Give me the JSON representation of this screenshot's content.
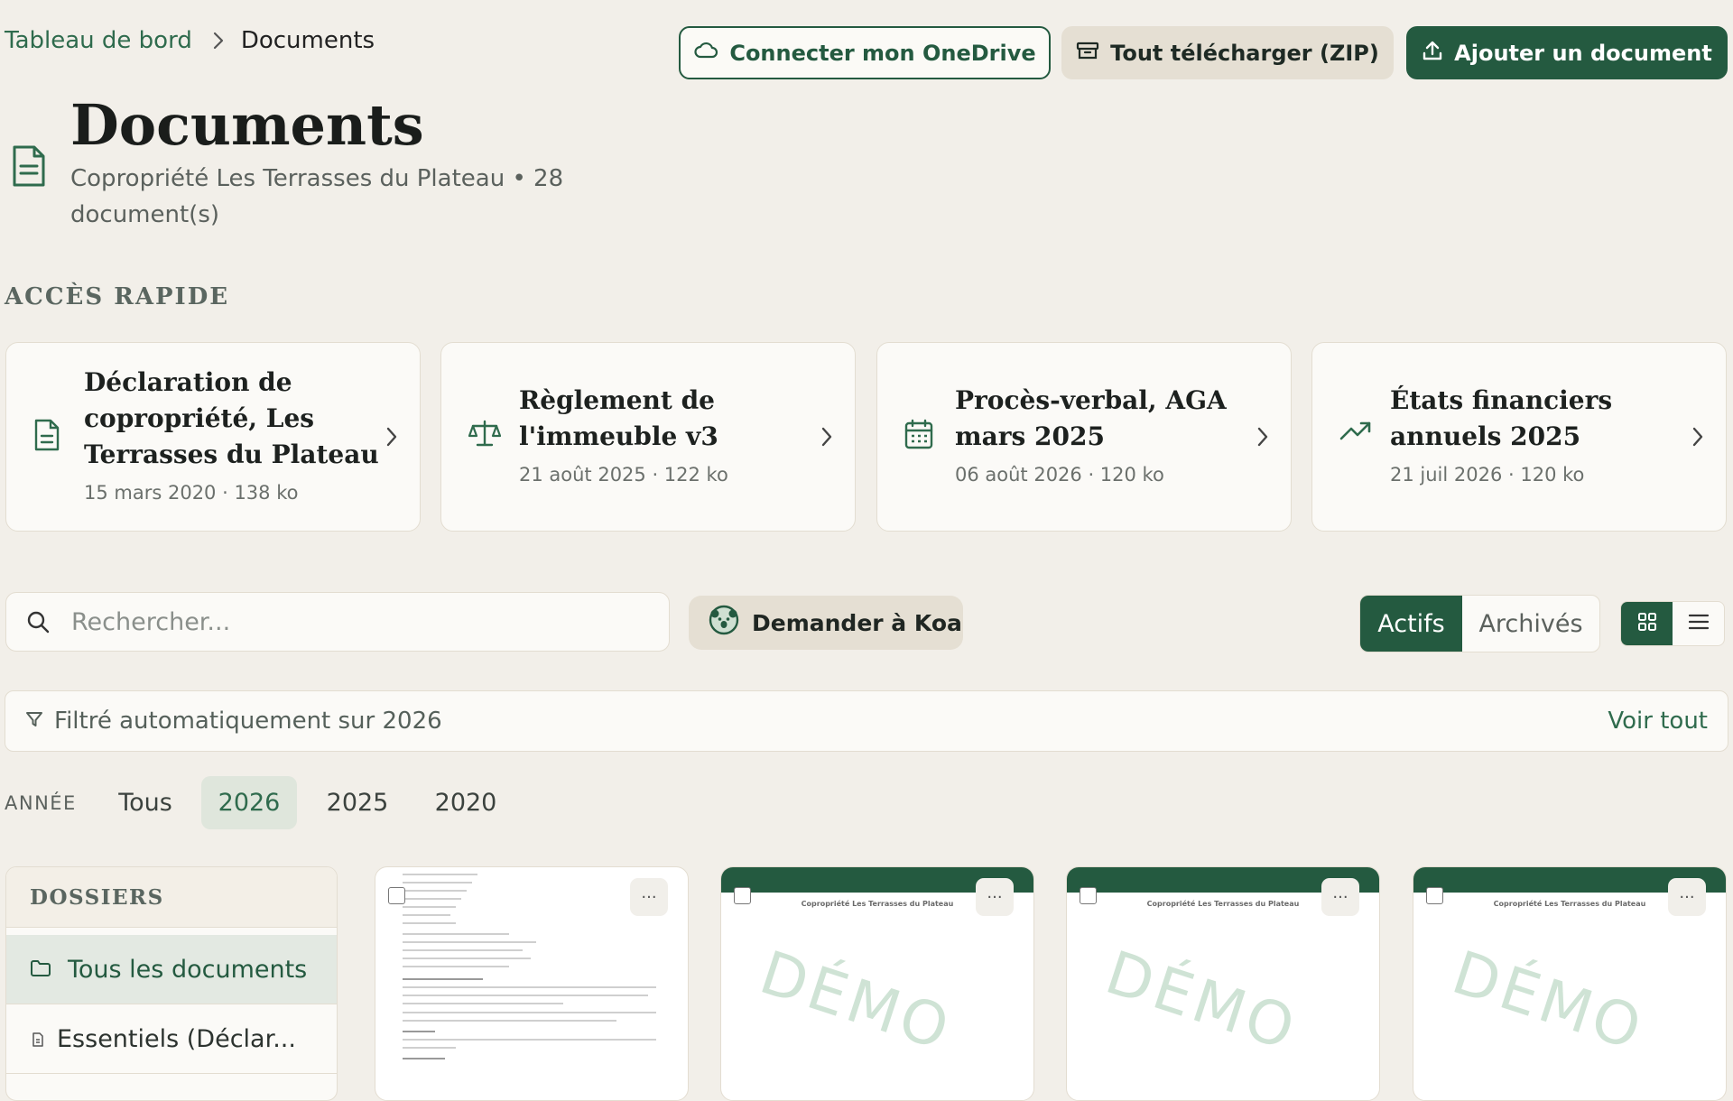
{
  "breadcrumb": {
    "home": "Tableau de bord",
    "current": "Documents"
  },
  "toolbar": {
    "onedrive_label": "Connecter mon OneDrive",
    "zip_label": "Tout télécharger (ZIP)",
    "add_label": "Ajouter un document"
  },
  "header": {
    "title": "Documents",
    "subtitle": "Copropriété Les Terrasses du Plateau • 28 document(s)"
  },
  "quick_access": {
    "label": "ACCÈS RAPIDE",
    "items": [
      {
        "title": "Déclaration de copropriété, Les Terrasses du Plateau",
        "meta": "15 mars 2020 · 138 ko",
        "icon": "document-icon"
      },
      {
        "title": "Règlement de l'immeuble v3",
        "meta": "21 août 2025 · 122 ko",
        "icon": "scale-icon"
      },
      {
        "title": "Procès-verbal, AGA mars 2025",
        "meta": "06 août 2026 · 120 ko",
        "icon": "calendar-icon"
      },
      {
        "title": "États financiers annuels 2025",
        "meta": "21 juil 2026 · 120 ko",
        "icon": "trending-up-icon"
      }
    ]
  },
  "search": {
    "placeholder": "Rechercher..."
  },
  "koa": {
    "label": "Demander à Koa"
  },
  "status_toggle": {
    "active": "Actifs",
    "archived": "Archivés",
    "selected": "Actifs"
  },
  "view_toggle": {
    "selected": "grid"
  },
  "filter_banner": {
    "text": "Filtré automatiquement sur 2026",
    "link": "Voir tout"
  },
  "years": {
    "label": "ANNÉE",
    "options": [
      "Tous",
      "2026",
      "2025",
      "2020"
    ],
    "selected": "2026"
  },
  "folders": {
    "label": "DOSSIERS",
    "items": [
      {
        "label": "Tous les documents",
        "selected": true
      },
      {
        "label": "Essentiels (Déclar...",
        "selected": false
      }
    ]
  },
  "tiles": [
    {
      "kind": "scan",
      "more": "···"
    },
    {
      "kind": "demo",
      "header": "Copropriété Les Terrasses du Plateau",
      "watermark": "DÉMO",
      "more": "···"
    },
    {
      "kind": "demo",
      "header": "Copropriété Les Terrasses du Plateau",
      "watermark": "DÉMO",
      "more": "···"
    },
    {
      "kind": "demo",
      "header": "Copropriété Les Terrasses du Plateau",
      "watermark": "DÉMO",
      "more": "···"
    }
  ],
  "colors": {
    "brand": "#245a40",
    "background": "#f2efe9",
    "link": "#2f6b4d"
  }
}
